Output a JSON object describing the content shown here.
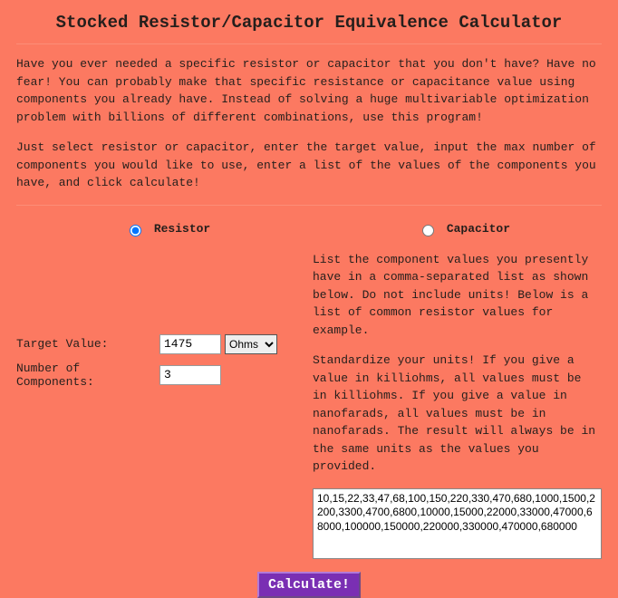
{
  "title": "Stocked Resistor/Capacitor Equivalence Calculator",
  "intro1": "Have you ever needed a specific resistor or capacitor that you don't have? Have no fear! You can probably make that specific resistance or capacitance value using components you already have. Instead of solving a huge multivariable optimization problem with billions of different combinations, use this program!",
  "intro2": "Just select resistor or capacitor, enter the target value, input the max number of components you would like to use, enter a list of the values of the components you have, and click calculate!",
  "radio": {
    "resistor": "Resistor",
    "capacitor": "Capacitor"
  },
  "left": {
    "target_label": "Target Value:",
    "target_value": "1475",
    "unit_selected": "Ohms",
    "num_label": "Number of Components:",
    "num_value": "3"
  },
  "right": {
    "p1": "List the component values you presently have in a comma-separated list as shown below. Do not include units! Below is a list of common resistor values for example.",
    "p2": "Standardize your units! If you give a value in killiohms, all values must be in killiohms. If you give a value in nanofarads, all values must be in nanofarads. The result will always be in the same units as the values you provided.",
    "values": "10,15,22,33,47,68,100,150,220,330,470,680,1000,1500,2200,3300,4700,6800,10000,15000,22000,33000,47000,68000,100000,150000,220000,330000,470000,680000"
  },
  "calc_label": "Calculate!"
}
